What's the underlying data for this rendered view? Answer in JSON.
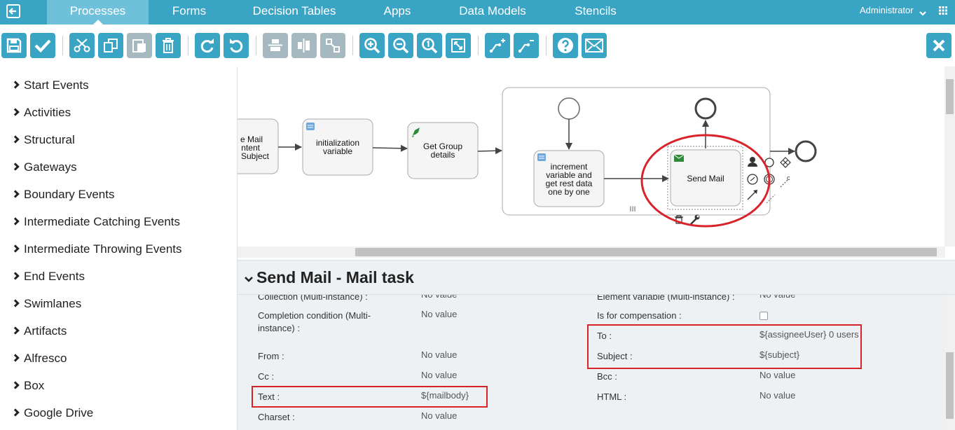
{
  "nav": {
    "tabs": [
      "Processes",
      "Forms",
      "Decision Tables",
      "Apps",
      "Data Models",
      "Stencils"
    ],
    "active_tab": "Processes",
    "user": "Administrator"
  },
  "toolbar": {
    "buttons": [
      "save-icon",
      "validate-icon",
      "cut-icon",
      "copy-icon",
      "paste-icon",
      "delete-icon",
      "redo-icon",
      "undo-icon",
      "align-vertical-icon",
      "align-horizontal-icon",
      "same-size-icon",
      "zoom-in-icon",
      "zoom-out-icon",
      "zoom-actual-icon",
      "zoom-fit-icon",
      "add-bendpoint-icon",
      "remove-bendpoint-icon",
      "help-icon",
      "feedback-mail-icon",
      "close-icon"
    ]
  },
  "palette": {
    "items": [
      "Start Events",
      "Activities",
      "Structural",
      "Gateways",
      "Boundary Events",
      "Intermediate Catching Events",
      "Intermediate Throwing Events",
      "End Events",
      "Swimlanes",
      "Artifacts",
      "Alfresco",
      "Box",
      "Google Drive"
    ]
  },
  "diagram": {
    "task1_lines": [
      "e Mail",
      "ntent",
      "Subject"
    ],
    "task2_lines": [
      "initialization",
      "variable"
    ],
    "task3_lines": [
      "Get Group",
      "details"
    ],
    "task4_lines": [
      "increment",
      "variable and",
      "get rest data",
      "one by one"
    ],
    "task5_lines": [
      "Send Mail"
    ],
    "c_label": "c",
    "subprocess_handle": "III"
  },
  "properties": {
    "title": "Send Mail - Mail task",
    "left": [
      {
        "label": "Collection (Multi-instance) :",
        "value": "No value"
      },
      {
        "label": "Completion condition (Multi-instance) :",
        "value": "No value"
      },
      {
        "label": "From :",
        "value": "No value"
      },
      {
        "label": "Cc :",
        "value": "No value"
      },
      {
        "label": "Text :",
        "value": "${mailbody}"
      },
      {
        "label": "Charset :",
        "value": "No value"
      }
    ],
    "right": [
      {
        "label": "Element variable (Multi-instance) :",
        "value": "No value"
      },
      {
        "label": "Is for compensation :",
        "value": ""
      },
      {
        "label": "To :",
        "value": "${assigneeUser} 0 users"
      },
      {
        "label": "Subject :",
        "value": "${subject}"
      },
      {
        "label": "Bcc :",
        "value": "No value"
      },
      {
        "label": "HTML :",
        "value": "No value"
      }
    ],
    "completion_label_lines": [
      "Completion condition (Multi-",
      "instance) :"
    ]
  },
  "colors": {
    "nav_bg": "#3aa4c4",
    "button_bg": "#3aa4c4",
    "button_disabled": "#a6b9c0",
    "highlight": "#d9232b",
    "panel_bg": "#eef1f3"
  }
}
